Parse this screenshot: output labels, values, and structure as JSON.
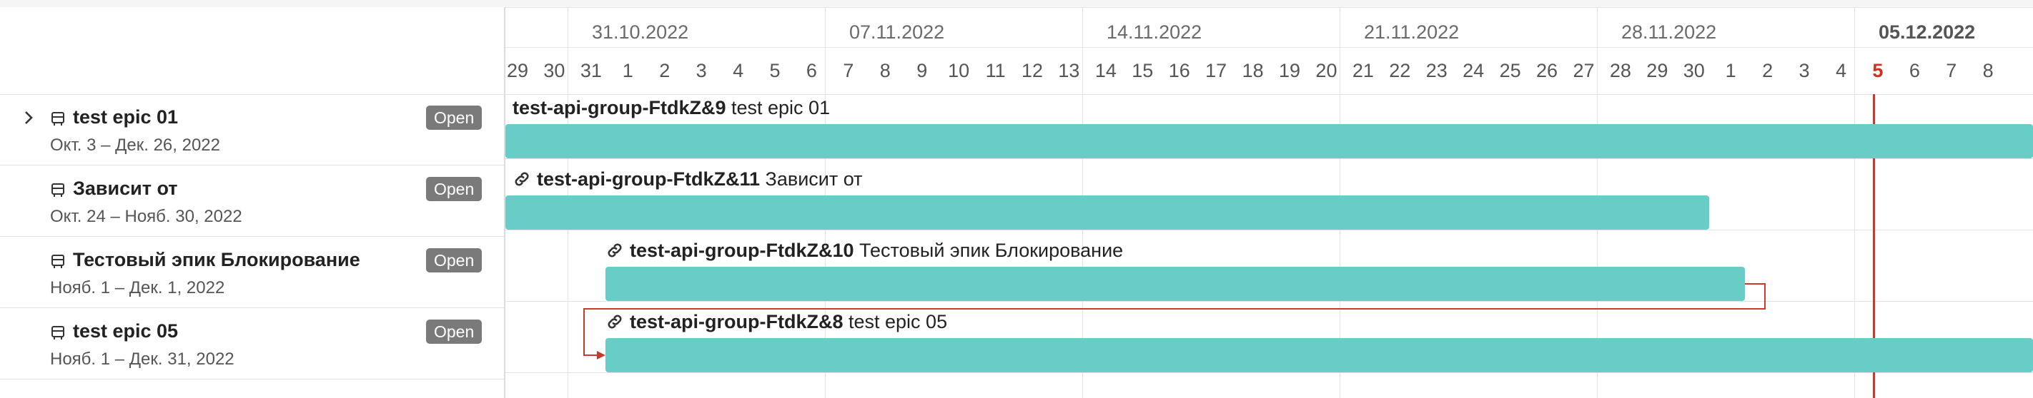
{
  "timeline": {
    "weeks": [
      {
        "label": "31.10.2022",
        "current": false
      },
      {
        "label": "07.11.2022",
        "current": false
      },
      {
        "label": "14.11.2022",
        "current": false
      },
      {
        "label": "21.11.2022",
        "current": false
      },
      {
        "label": "28.11.2022",
        "current": false
      },
      {
        "label": "05.12.2022",
        "current": true
      }
    ],
    "days": [
      "29",
      "30",
      "31",
      "1",
      "2",
      "3",
      "4",
      "5",
      "6",
      "7",
      "8",
      "9",
      "10",
      "11",
      "12",
      "13",
      "14",
      "15",
      "16",
      "17",
      "18",
      "19",
      "20",
      "21",
      "22",
      "23",
      "24",
      "25",
      "26",
      "27",
      "28",
      "29",
      "30",
      "1",
      "2",
      "3",
      "4",
      "5",
      "6",
      "7",
      "8"
    ],
    "today": "5",
    "today_color": "#c73a2c"
  },
  "epics": [
    {
      "title": "test epic 01",
      "dates": "Окт. 3 – Дек. 26, 2022",
      "status": "Open",
      "expandable": true,
      "bar_key": "test-api-group-FtdkZ&9",
      "bar_name": "test epic 01",
      "has_link": false
    },
    {
      "title": "Зависит от",
      "dates": "Окт. 24 – Нояб. 30, 2022",
      "status": "Open",
      "expandable": false,
      "bar_key": "test-api-group-FtdkZ&11",
      "bar_name": "Зависит от",
      "has_link": true
    },
    {
      "title": "Тестовый эпик Блокирование",
      "dates": "Нояб. 1 – Дек. 1, 2022",
      "status": "Open",
      "expandable": false,
      "bar_key": "test-api-group-FtdkZ&10",
      "bar_name": "Тестовый эпик Блокирование",
      "has_link": true
    },
    {
      "title": "test epic 05",
      "dates": "Нояб. 1 – Дек. 31, 2022",
      "status": "Open",
      "expandable": false,
      "bar_key": "test-api-group-FtdkZ&8",
      "bar_name": "test epic 05",
      "has_link": true
    }
  ],
  "colors": {
    "bar": "#68cdc6",
    "status_badge": "#7a7a7a",
    "dependency_arrow": "#c73a2c"
  }
}
